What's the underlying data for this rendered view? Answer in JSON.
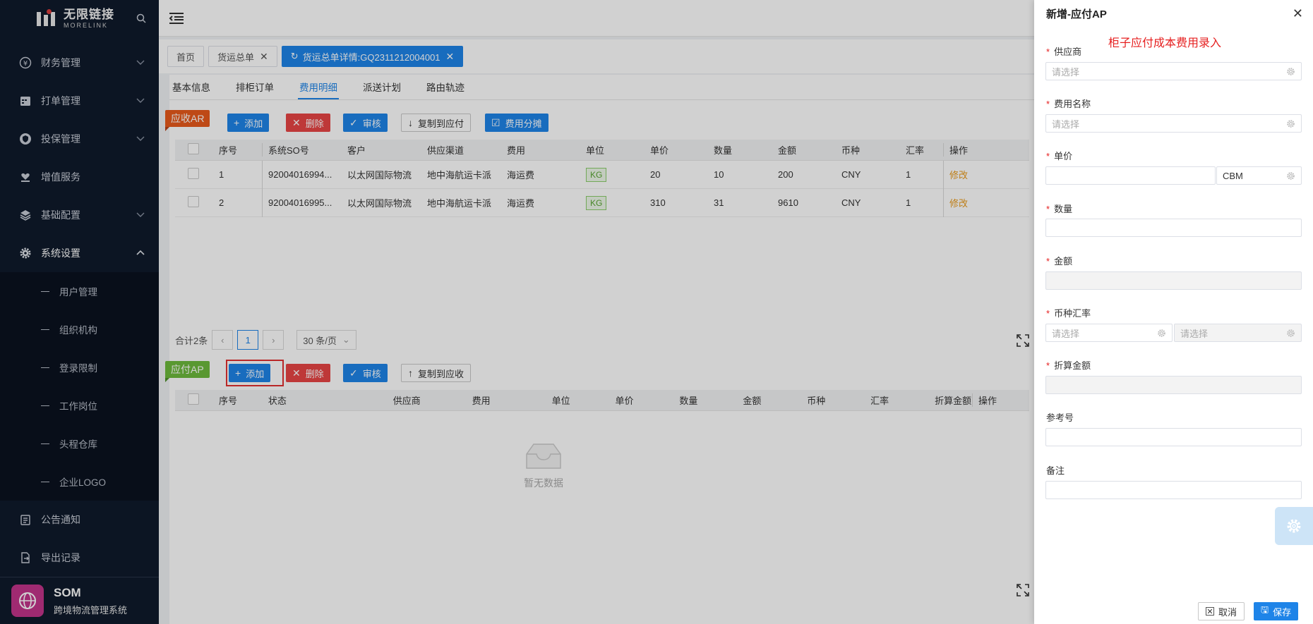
{
  "sidebar": {
    "logo_cn": "无限链接",
    "logo_en": "MORELINK",
    "items": [
      {
        "label": "财务管理",
        "icon": "yen-icon"
      },
      {
        "label": "打单管理",
        "icon": "calendar-icon"
      },
      {
        "label": "投保管理",
        "icon": "shield-icon"
      },
      {
        "label": "增值服务",
        "icon": "heart-hand-icon"
      },
      {
        "label": "基础配置",
        "icon": "layers-icon"
      },
      {
        "label": "系统设置",
        "icon": "gear-icon"
      }
    ],
    "sub_items": [
      "用户管理",
      "组织机构",
      "登录限制",
      "工作岗位",
      "头程仓库",
      "企业LOGO"
    ],
    "bottom_items": [
      {
        "label": "公告通知",
        "icon": "notice-icon"
      },
      {
        "label": "导出记录",
        "icon": "export-icon"
      }
    ],
    "footer": {
      "name": "SOM",
      "subtitle": "跨境物流管理系统"
    }
  },
  "page_tabs": [
    {
      "label": "首页"
    },
    {
      "label": "货运总单"
    },
    {
      "label": "货运总单详情:GQ2311212004001"
    }
  ],
  "sub_tabs": [
    "基本信息",
    "排柜订单",
    "费用明细",
    "派送计划",
    "路由轨迹"
  ],
  "ar": {
    "tag": "应收AR",
    "buttons": {
      "add": "添加",
      "delete": "删除",
      "audit": "审核",
      "copy": "复制到应付",
      "split": "费用分摊"
    },
    "columns": [
      "序号",
      "系统SO号",
      "客户",
      "供应渠道",
      "费用",
      "单位",
      "单价",
      "数量",
      "金额",
      "币种",
      "汇率",
      "操作"
    ],
    "rows": [
      {
        "no": "1",
        "so": "92004016994...",
        "customer": "以太网国际物流",
        "channel": "地中海航运卡派",
        "fee": "海运费",
        "unit": "KG",
        "price": "20",
        "qty": "10",
        "amount": "200",
        "currency": "CNY",
        "rate": "1",
        "op": "修改"
      },
      {
        "no": "2",
        "so": "92004016995...",
        "customer": "以太网国际物流",
        "channel": "地中海航运卡派",
        "fee": "海运费",
        "unit": "KG",
        "price": "310",
        "qty": "31",
        "amount": "9610",
        "currency": "CNY",
        "rate": "1",
        "op": "修改"
      }
    ],
    "pager": {
      "total": "合计2条",
      "page": "1",
      "size": "30 条/页"
    }
  },
  "ap": {
    "tag": "应付AP",
    "buttons": {
      "add": "添加",
      "delete": "删除",
      "audit": "审核",
      "copy": "复制到应收"
    },
    "columns": [
      "序号",
      "状态",
      "供应商",
      "费用",
      "单位",
      "单价",
      "数量",
      "金额",
      "币种",
      "汇率",
      "折算金额",
      "操作"
    ],
    "empty": "暂无数据"
  },
  "drawer": {
    "title": "新增-应付AP",
    "note": "柜子应付成本费用录入",
    "fields": {
      "supplier": {
        "label": "供应商",
        "placeholder": "请选择"
      },
      "fee_name": {
        "label": "费用名称",
        "placeholder": "请选择"
      },
      "unit_price": {
        "label": "单价",
        "unit": "CBM"
      },
      "quantity": {
        "label": "数量"
      },
      "amount": {
        "label": "金额"
      },
      "currency_rate": {
        "label": "币种汇率",
        "placeholder1": "请选择",
        "placeholder2": "请选择"
      },
      "converted": {
        "label": "折算金额"
      },
      "reference": {
        "label": "参考号"
      },
      "remark": {
        "label": "备注"
      }
    },
    "cancel": "取消",
    "save": "保存"
  },
  "colors": {
    "primary": "#1e84e8",
    "danger": "#e84545",
    "ar_tag": "#e85a1c",
    "ap_tag": "#6dba3c",
    "sidebar_bg": "#0f1a2b"
  }
}
